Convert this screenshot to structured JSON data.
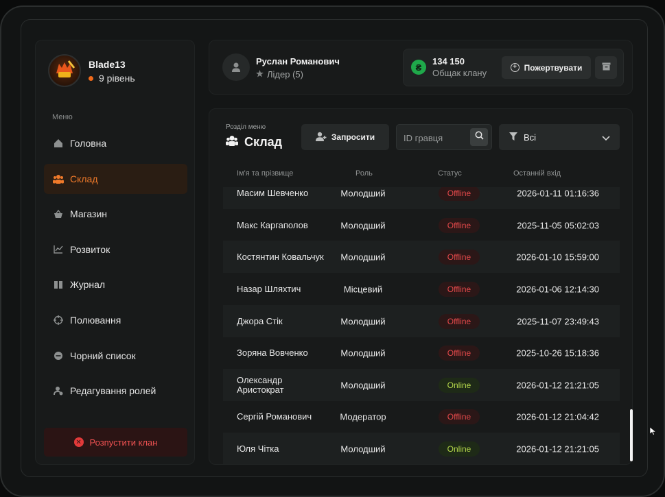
{
  "profile": {
    "name": "Blade13",
    "level": "9 рівень"
  },
  "menu": {
    "label": "Меню",
    "items": [
      {
        "label": "Головна",
        "icon": "home-icon"
      },
      {
        "label": "Склад",
        "icon": "users-icon",
        "active": true
      },
      {
        "label": "Магазин",
        "icon": "basket-icon"
      },
      {
        "label": "Розвиток",
        "icon": "chart-icon"
      },
      {
        "label": "Журнал",
        "icon": "book-icon"
      },
      {
        "label": "Полювання",
        "icon": "crosshair-icon"
      },
      {
        "label": "Чорний список",
        "icon": "block-icon"
      },
      {
        "label": "Редагування ролей",
        "icon": "user-edit-icon"
      }
    ],
    "disband": "Розпустити клан"
  },
  "user": {
    "name": "Руслан Романович",
    "role": "Лідер (5)"
  },
  "bank": {
    "currency_symbol": "₴",
    "amount": "134 150",
    "label": "Общак клану",
    "donate": "Пожертвувати"
  },
  "section": {
    "label": "Розділ меню",
    "title": "Склад"
  },
  "toolbar": {
    "invite": "Запросити",
    "search_placeholder": "ID гравця",
    "filter": "Всі"
  },
  "table": {
    "headers": {
      "name": "Ім'я та прізвище",
      "role": "Роль",
      "status": "Статус",
      "last": "Останній вхід"
    },
    "rows": [
      {
        "name": "Масим Шевченко",
        "role": "Молодший",
        "status": "Offline",
        "last": "2026-01-11 01:16:36"
      },
      {
        "name": "Макс Каргаполов",
        "role": "Молодший",
        "status": "Offline",
        "last": "2025-11-05 05:02:03"
      },
      {
        "name": "Костянтин Ковальчук",
        "role": "Молодший",
        "status": "Offline",
        "last": "2026-01-10 15:59:00"
      },
      {
        "name": "Назар Шляхтич",
        "role": "Місцевий",
        "status": "Offline",
        "last": "2026-01-06 12:14:30"
      },
      {
        "name": "Джора Стік",
        "role": "Молодший",
        "status": "Offline",
        "last": "2025-11-07 23:49:43"
      },
      {
        "name": "Зоряна Вовченко",
        "role": "Молодший",
        "status": "Offline",
        "last": "2025-10-26 15:18:36"
      },
      {
        "name": "Олександр Аристократ",
        "role": "Молодший",
        "status": "Online",
        "last": "2026-01-12 21:21:05"
      },
      {
        "name": "Сергій Романович",
        "role": "Модератор",
        "status": "Offline",
        "last": "2026-01-12 21:04:42"
      },
      {
        "name": "Юля Чітка",
        "role": "Молодший",
        "status": "Online",
        "last": "2026-01-12 21:21:05"
      }
    ]
  },
  "colors": {
    "accent": "#f07a2a",
    "offline": "#e5494b",
    "online": "#b3d64a",
    "coin": "#1fa84a"
  }
}
